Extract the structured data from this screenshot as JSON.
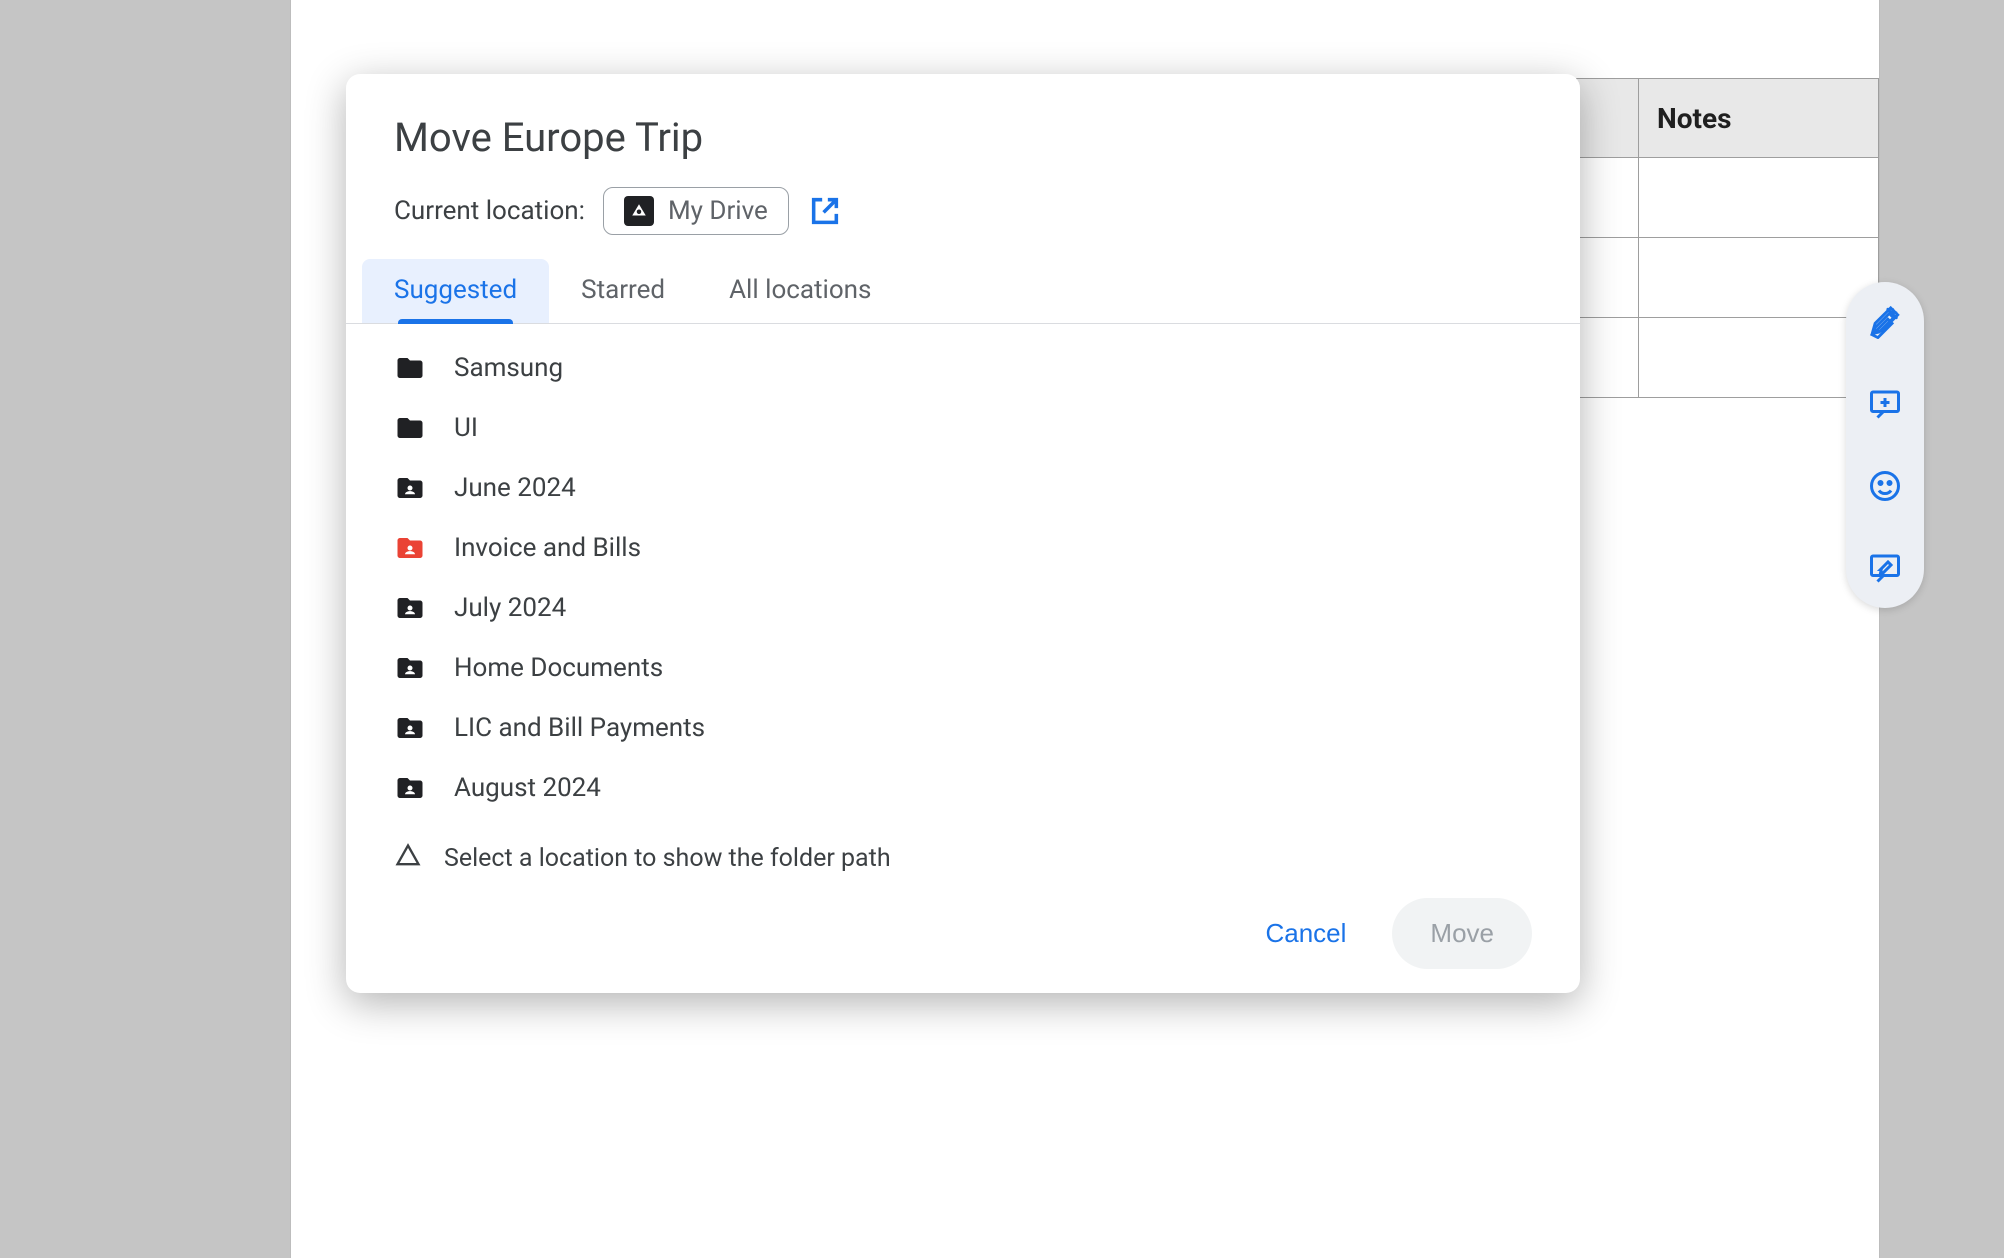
{
  "dialog": {
    "title": "Move Europe Trip",
    "location_label": "Current location:",
    "location_chip": "My Drive",
    "tabs": [
      {
        "label": "Suggested",
        "active": true
      },
      {
        "label": "Starred",
        "active": false
      },
      {
        "label": "All locations",
        "active": false
      }
    ],
    "folders": [
      {
        "name": "Samsung",
        "icon": "folder",
        "color": "#202124"
      },
      {
        "name": "UI",
        "icon": "folder",
        "color": "#202124"
      },
      {
        "name": "June 2024",
        "icon": "folder-shared",
        "color": "#202124"
      },
      {
        "name": "Invoice and Bills",
        "icon": "folder-shared",
        "color": "#ea4335"
      },
      {
        "name": "July 2024",
        "icon": "folder-shared",
        "color": "#202124"
      },
      {
        "name": "Home Documents",
        "icon": "folder-shared",
        "color": "#202124"
      },
      {
        "name": "LIC and Bill Payments",
        "icon": "folder-shared",
        "color": "#202124"
      },
      {
        "name": "August 2024",
        "icon": "folder-shared",
        "color": "#202124"
      }
    ],
    "hint": "Select a location to show the folder path",
    "cancel": "Cancel",
    "move": "Move"
  },
  "background": {
    "column_header": "Notes"
  },
  "sidepill": {
    "icons": [
      "gemini-icon",
      "add-comment-icon",
      "emoji-icon",
      "suggest-edit-icon"
    ]
  }
}
